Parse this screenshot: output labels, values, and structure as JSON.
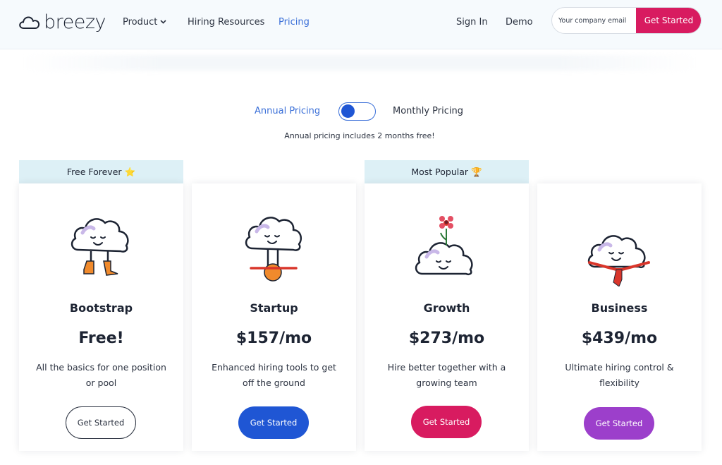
{
  "header": {
    "logo_text": "breezy",
    "nav": {
      "product": "Product",
      "hiring_resources": "Hiring Resources",
      "pricing": "Pricing",
      "sign_in": "Sign In",
      "demo": "Demo"
    },
    "email_placeholder": "Your company email",
    "cta_label": "Get Started"
  },
  "pricing_toggle": {
    "annual_label": "Annual Pricing",
    "monthly_label": "Monthly Pricing",
    "selected": "Annual Pricing",
    "note": "Annual pricing includes 2 months free!"
  },
  "plans": [
    {
      "badge": "Free Forever",
      "badge_emoji": "⭐",
      "name": "Bootstrap",
      "price": "Free!",
      "description": "All the basics for one position or pool",
      "cta": "Get Started",
      "button_color": "#ffffff",
      "illustration": "cloud-with-boots-icon"
    },
    {
      "name": "Startup",
      "price": "$157/mo",
      "description": "Enhanced hiring tools to get off the ground",
      "cta": "Get Started",
      "button_color": "#1f56d4",
      "illustration": "cloud-on-unicycle-icon"
    },
    {
      "badge": "Most Popular",
      "badge_emoji": "🏆",
      "name": "Growth",
      "price": "$273/mo",
      "description": "Hire better together with a growing team",
      "cta": "Get Started",
      "button_color": "#d81b60",
      "illustration": "cloud-with-flower-icon"
    },
    {
      "name": "Business",
      "price": "$439/mo",
      "description": "Ultimate hiring control & flexibility",
      "cta": "Get Started",
      "button_color": "#9c3fcb",
      "illustration": "cloud-with-tie-icon"
    }
  ],
  "colors": {
    "brand_pink": "#d81b60",
    "brand_blue": "#1f56d4",
    "brand_purple": "#9c3fcb",
    "badge_bg": "#ddf0f6",
    "link_blue": "#3a6fd8"
  }
}
